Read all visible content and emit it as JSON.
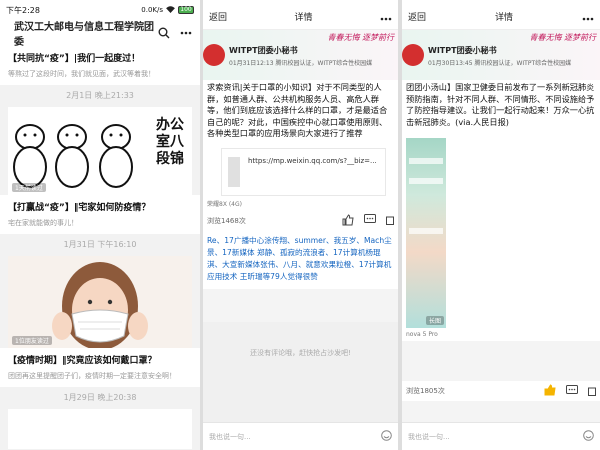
{
  "colors": {
    "accent_red": "#d32f2f",
    "link_blue": "#1565c0",
    "muted": "#999999",
    "like_yellow": "#f5b400"
  },
  "status_bar": {
    "time": "下午2:28",
    "speed": "0.0K/s",
    "battery": "100"
  },
  "feed": {
    "title": "武汉工大邮电与信息工程学院团委",
    "search_icon": "search-icon",
    "more_icon": "more-icon",
    "cards": [
      {
        "title": "【共同抗“疫”】|我们一起度过！",
        "subtitle": "等熬过了这段时间，我们就见面，武汉等着我！"
      },
      {
        "date": "2月1日 晚上21:33",
        "image_overlay": "1天前读过",
        "image_text": "办公室八段锦",
        "title": "【打赢战“疫”】‖宅家如何防疫情？",
        "subtitle": "宅在家就能做的事儿！"
      },
      {
        "date": "1月31日 下午16:10",
        "image_overlay": "1位朋友读过",
        "title": "【疫情时期】‖究竟应该如何戴口罩？",
        "subtitle": "团团再这里提醒团子们，疫情时期一定要注意安全啊！"
      },
      {
        "date": "1月29日 晚上20:38"
      }
    ]
  },
  "detail1": {
    "back_label": "返回",
    "header_title": "详情",
    "more_icon": "more-icon",
    "slogan": "青春无悔 逐梦前行",
    "account_name": "WITPT团委小秘书",
    "meta": "01月31日12:13  腾讯校园认证，WITPT综合性校园媒",
    "article": "求索资讯|关于口罩的小知识】对于不同类型的人群，如普通人群、公共机构服务人员、高危人群等，他们到底应该选择什么样的口罩，才是最适合自己的呢？对此，中国疾控中心就口罩使用原则、各种类型口罩的应用场景向大家进行了推荐",
    "link_url": "https://mp.weixin.qq.com/s?__biz=...",
    "device": "荣耀8X (4G)",
    "reads": "浏览1468次",
    "likers": "Re、17广播中心涂传翔、summer、我五岁、Mach尘景、17新媒体 郑静、孤寂的流浪者、17计算机杨琨淇、大宣新媒体张伟、八月、就意欢果粒橙、17计算机应用技术 王昕瑞等79人觉得很赞",
    "no_comment": "还没有评论哦，赶快抢占沙发吧!",
    "comment_placeholder": "我也说一句..."
  },
  "detail2": {
    "back_label": "返回",
    "header_title": "详情",
    "more_icon": "more-icon",
    "slogan": "青春无悔 逐梦前行",
    "account_name": "WITPT团委小秘书",
    "meta": "01月30日13:45  腾讯校园认证，WITPT综合性校园媒",
    "article": "团团小汤山】国家卫健委日前发布了一系列新冠肺炎预防指南，针对不同人群、不同情形、不同设施给予了防控指导建议。让我们一起行动起来！万众一心抗击新冠肺炎。(via.人民日报)",
    "device": "nova 5 Pro",
    "image_overlay": "长图",
    "reads": "浏览1805次",
    "comment_placeholder": "我也说一句..."
  }
}
